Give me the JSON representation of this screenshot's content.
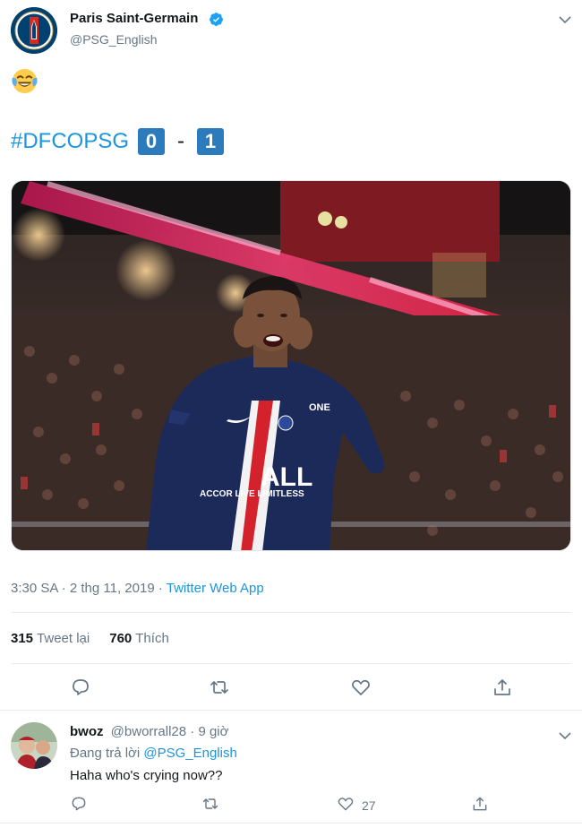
{
  "tweet": {
    "author_name": "Paris Saint-Germain",
    "author_handle": "@PSG_English",
    "emoji": "😂",
    "hashtag": "#DFCOPSG",
    "score_home": "0",
    "score_separator": "-",
    "score_away": "1",
    "photo_kit_text": "ALL",
    "photo_kit_sub": "ACCOR LIVE LIMITLESS",
    "photo_sleeve_text": "ONE",
    "timestamp": "3:30 SA · 2 thg 11, 2019",
    "source_separator": "·",
    "source": "Twitter Web App",
    "retweets_count": "315",
    "retweets_label": "Tweet lại",
    "likes_count": "760",
    "likes_label": "Thích"
  },
  "reply": {
    "name": "bwoz",
    "handle": "@bworrall28",
    "time": "· 9 giờ",
    "replying_prefix": "Đang trả lời",
    "replying_to": "@PSG_English",
    "text": "Haha who's crying now??",
    "likes_count": "27"
  },
  "colors": {
    "link": "#1b95e0",
    "secondary_text": "#657786",
    "score_box": "#2b7bbd",
    "divider": "#e6ecf0"
  },
  "icons": [
    "verified-icon",
    "chevron-down-icon",
    "reply-icon",
    "retweet-icon",
    "like-icon",
    "share-icon"
  ]
}
